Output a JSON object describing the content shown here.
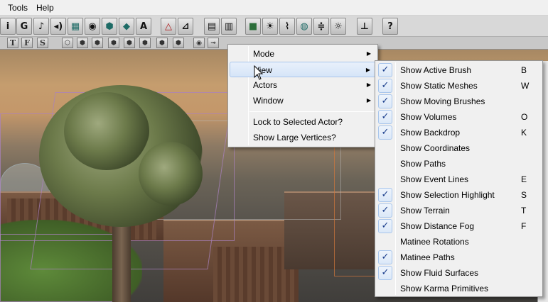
{
  "menubar": {
    "items": [
      "Tools",
      "Help"
    ]
  },
  "toolbar": {
    "main_icons": [
      {
        "name": "info-icon",
        "glyph": "i"
      },
      {
        "name": "g-icon",
        "glyph": "G"
      },
      {
        "name": "music-note-icon",
        "glyph": "♪"
      },
      {
        "name": "speaker-icon",
        "glyph": "◂)"
      },
      {
        "name": "landscape-icon",
        "glyph": "▦"
      },
      {
        "name": "eye-icon",
        "glyph": "◉"
      },
      {
        "name": "mesh-icon",
        "glyph": "⬢"
      },
      {
        "name": "shape-icon",
        "glyph": "◆"
      },
      {
        "name": "font-icon",
        "glyph": "A"
      },
      {
        "name": "triangle-icon",
        "glyph": "△"
      },
      {
        "name": "skew-icon",
        "glyph": "⊿"
      },
      {
        "name": "browser-icon",
        "glyph": "▤"
      },
      {
        "name": "browser-alt-icon",
        "glyph": "▥"
      },
      {
        "name": "cube-icon",
        "glyph": "■"
      },
      {
        "name": "light-icon",
        "glyph": "☀"
      },
      {
        "name": "path-icon",
        "glyph": "⌇"
      },
      {
        "name": "props-icon",
        "glyph": "◍"
      },
      {
        "name": "sliders-icon",
        "glyph": "≑"
      },
      {
        "name": "bulb-icon",
        "glyph": "☼"
      },
      {
        "name": "actor-icon",
        "glyph": "⊥"
      },
      {
        "name": "help-cursor-icon",
        "glyph": "?"
      }
    ],
    "secondary_icons": [
      {
        "name": "top-view-icon",
        "glyph": "T"
      },
      {
        "name": "front-view-icon",
        "glyph": "F"
      },
      {
        "name": "side-view-icon",
        "glyph": "S"
      },
      {
        "name": "wireframe-cube-icon",
        "glyph": "⬡"
      },
      {
        "name": "zone-cube-icon",
        "glyph": "⬢"
      },
      {
        "name": "textured-cube-icon",
        "glyph": "⬢"
      },
      {
        "name": "lit-cube-icon",
        "glyph": "⬢"
      },
      {
        "name": "solid-cube-icon",
        "glyph": "⬢"
      },
      {
        "name": "depth-cube-icon",
        "glyph": "⬢"
      },
      {
        "name": "unlit-cube-icon",
        "glyph": "⬢"
      },
      {
        "name": "overdraw-cube-icon",
        "glyph": "⬢"
      },
      {
        "name": "realtime-eye-icon",
        "glyph": "◉"
      },
      {
        "name": "lock-icon",
        "glyph": "⊸"
      }
    ]
  },
  "menu_main": {
    "items": [
      {
        "label": "Mode",
        "submenu": true
      },
      {
        "label": "View",
        "submenu": true
      },
      {
        "label": "Actors",
        "submenu": true
      },
      {
        "label": "Window",
        "submenu": true
      },
      {
        "label": "Lock to Selected Actor?",
        "submenu": false
      },
      {
        "label": "Show Large Vertices?",
        "submenu": false
      }
    ]
  },
  "menu_view": {
    "items": [
      {
        "label": "Show Active Brush",
        "key": "B",
        "checked": true
      },
      {
        "label": "Show Static Meshes",
        "key": "W",
        "checked": true
      },
      {
        "label": "Show Moving Brushes",
        "key": "",
        "checked": true
      },
      {
        "label": "Show Volumes",
        "key": "O",
        "checked": true
      },
      {
        "label": "Show Backdrop",
        "key": "K",
        "checked": true
      },
      {
        "label": "Show Coordinates",
        "key": "",
        "checked": false
      },
      {
        "label": "Show Paths",
        "key": "",
        "checked": false
      },
      {
        "label": "Show Event Lines",
        "key": "E",
        "checked": false
      },
      {
        "label": "Show Selection Highlight",
        "key": "S",
        "checked": true
      },
      {
        "label": "Show Terrain",
        "key": "T",
        "checked": true
      },
      {
        "label": "Show Distance Fog",
        "key": "F",
        "checked": true
      },
      {
        "label": "Matinee Rotations",
        "key": "",
        "checked": false
      },
      {
        "label": "Matinee Paths",
        "key": "",
        "checked": true
      },
      {
        "label": "Show Fluid Surfaces",
        "key": "",
        "checked": true
      },
      {
        "label": "Show Karma Primitives",
        "key": "",
        "checked": false
      }
    ]
  },
  "check_glyph": "✓",
  "arrow_glyph": "▶"
}
